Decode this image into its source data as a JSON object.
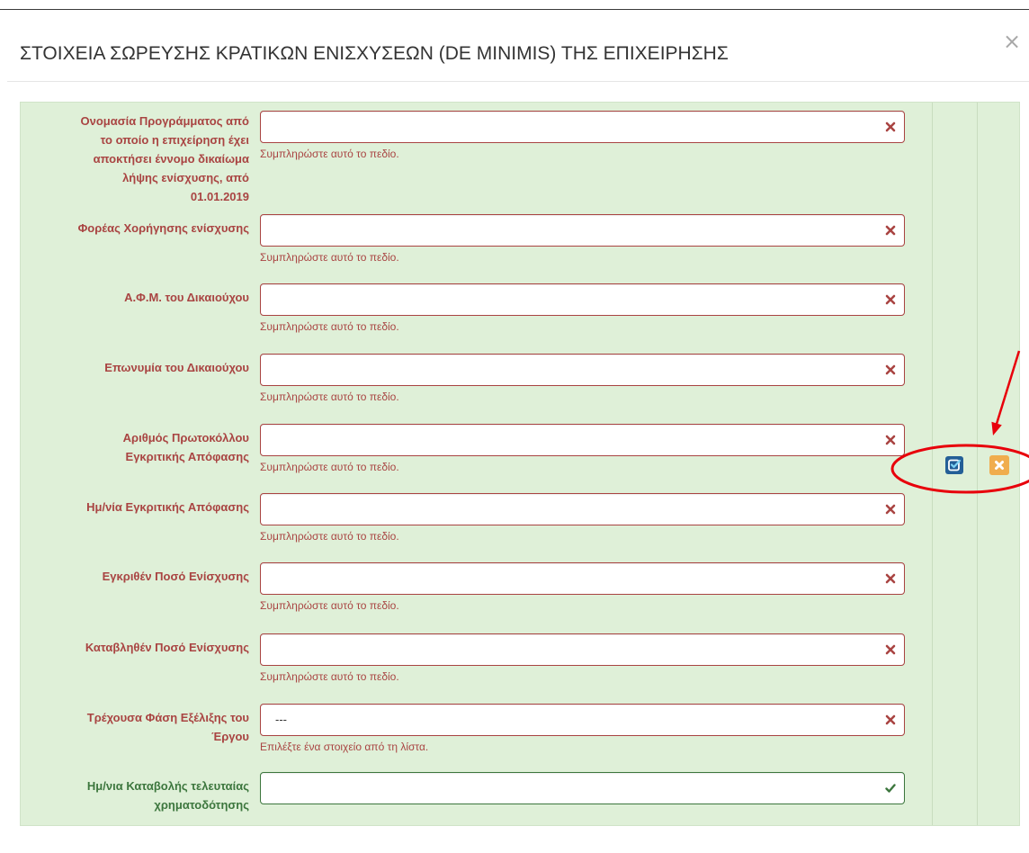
{
  "modal": {
    "title": "ΣΤΟΙΧΕΙΑ ΣΩΡΕΥΣΗΣ ΚΡΑΤΙΚΩΝ ΕΝΙΣΧΥΣΕΩΝ (DE MINIMIS) ΤΗΣ ΕΠΙΧΕΙΡΗΣΗΣ",
    "close_label": "×",
    "close_icon": "close-icon"
  },
  "form": {
    "rows": [
      {
        "label_lines": [
          "Ονομασία Προγράμματος από",
          "το οποίο η επιχείρηση έχει",
          "αποκτήσει έννομο δικαίωμα",
          "λήψης ενίσχυσης, από",
          "01.01.2019"
        ],
        "value": "",
        "help": "Συμπληρώστε αυτό το πεδίο.",
        "status_icon": "error-x-icon"
      },
      {
        "label_lines": [
          "Φορέας Χορήγησης ενίσχυσης"
        ],
        "value": "",
        "help": "Συμπληρώστε αυτό το πεδίο.",
        "status_icon": "error-x-icon"
      },
      {
        "label_lines": [
          "Α.Φ.Μ. του Δικαιούχου"
        ],
        "value": "",
        "help": "Συμπληρώστε αυτό το πεδίο.",
        "status_icon": "error-x-icon"
      },
      {
        "label_lines": [
          "Επωνυμία του Δικαιούχου"
        ],
        "value": "",
        "help": "Συμπληρώστε αυτό το πεδίο.",
        "status_icon": "error-x-icon"
      },
      {
        "label_lines": [
          "Αριθμός Πρωτοκόλλου",
          "Εγκριτικής Απόφασης"
        ],
        "value": "",
        "help": "Συμπληρώστε αυτό το πεδίο.",
        "status_icon": "error-x-icon"
      },
      {
        "label_lines": [
          "Ημ/νία Εγκριτικής Απόφασης"
        ],
        "value": "",
        "help": "Συμπληρώστε αυτό το πεδίο.",
        "status_icon": "error-x-icon"
      },
      {
        "label_lines": [
          "Εγκριθέν Ποσό Ενίσχυσης"
        ],
        "value": "",
        "help": "Συμπληρώστε αυτό το πεδίο.",
        "status_icon": "error-x-icon"
      },
      {
        "label_lines": [
          "Καταβληθέν Ποσό Ενίσχυσης"
        ],
        "value": "",
        "help": "Συμπληρώστε αυτό το πεδίο.",
        "status_icon": "error-x-icon"
      },
      {
        "label_lines": [
          "Τρέχουσα Φάση Εξέλιξης του",
          "Έργου"
        ],
        "value": "---",
        "help": "Επιλέξτε ένα στοιχείο από τη λίστα.",
        "status_icon": "error-x-icon"
      },
      {
        "label_lines": [
          "Ημ/νια Καταβολής τελευταίας",
          "χρηματοδότησης"
        ],
        "value": "",
        "status_icon": "success-check-icon"
      }
    ]
  },
  "row_actions": {
    "edit_icon": "edit-icon",
    "delete_icon": "delete-icon"
  },
  "colors": {
    "error": "#a94442",
    "success": "#3c763d",
    "panel_background": "#dff0d8",
    "edit_button": "#245f97",
    "delete_button": "#f0ad4e",
    "annotation": "#e8000b"
  }
}
